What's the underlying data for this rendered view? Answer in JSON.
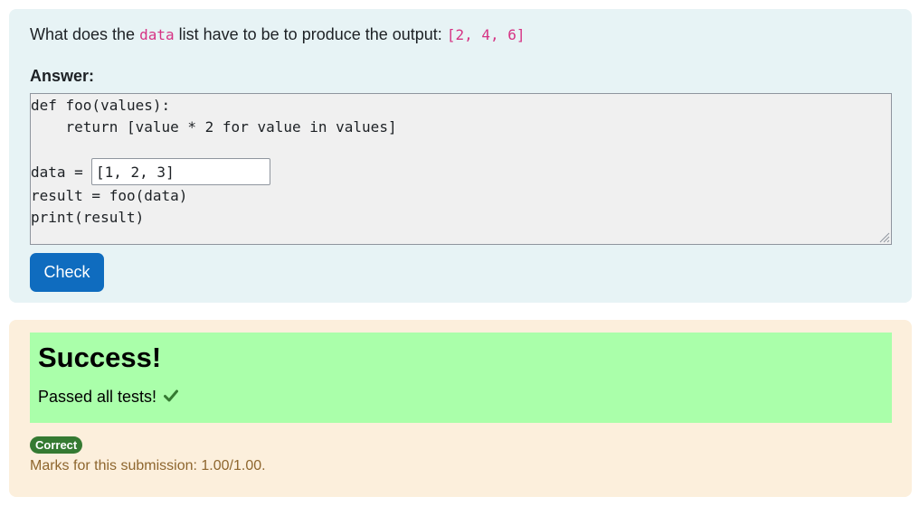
{
  "question": {
    "prefix": "What does the ",
    "code_word": "data",
    "suffix": " list have to be to produce the output: ",
    "output_value": "[2, 4, 6]",
    "answer_label": "Answer:"
  },
  "code": {
    "line1": "def foo(values):",
    "line2": "    return [value * 2 for value in values]",
    "line3_prefix": "data = ",
    "input_value": "[1, 2, 3]",
    "line4": "result = foo(data)",
    "line5": "print(result)"
  },
  "check_button": {
    "label": "Check"
  },
  "feedback": {
    "title": "Success!",
    "message": "Passed all tests!",
    "message_icon": "checkmark-icon",
    "badge": "Correct",
    "marks": "Marks for this submission: 1.00/1.00."
  },
  "colors": {
    "question_bg": "#e7f3f5",
    "feedback_bg": "#fcefdc",
    "success_bg": "#aaffaa",
    "button_blue": "#0f6cbf",
    "badge_green": "#357a32",
    "inline_code_pink": "#d63384",
    "marks_text": "#8e662e"
  }
}
